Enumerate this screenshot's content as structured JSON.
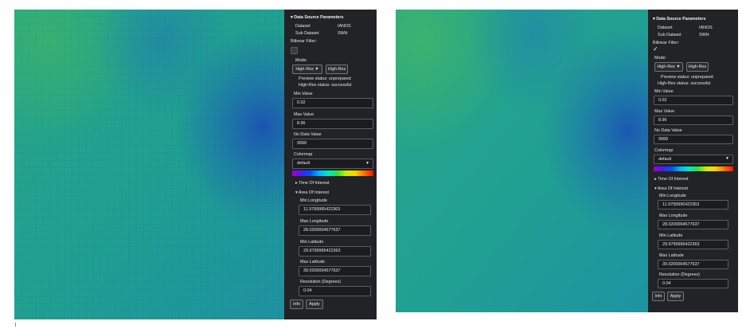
{
  "screens": [
    {
      "id": "left",
      "panel": {
        "section_title": "▾ Data Source Parameters",
        "dataset_label": "Dataset",
        "dataset_value": "IANOS",
        "subdataset_label": "Sub Dataset",
        "subdataset_value": "SWH",
        "bilinear_label": "Bilinear Filter:",
        "bilinear_checked": false,
        "mode_label": "Mode:",
        "mode_selected": "High-Res ▼",
        "mode_button": "High-Res",
        "preview_status": "Preview status: unprepared",
        "highres_status": "High-Res status: successful",
        "min_value_label": "Min Value",
        "min_value": "0.02",
        "max_value_label": "Max Value",
        "max_value": "8.96",
        "no_data_label": "No Data Value",
        "no_data_value": "9999",
        "colormap_label": "Colormap",
        "colormap_value": "default",
        "time_interest": "▸ Time Of Interest",
        "area_interest": "▾ Area Of Interest",
        "min_lon_label": "Min Longitude",
        "min_lon": "11.9799995422363",
        "max_lon_label": "Max Longitude",
        "max_lon": "28.0200004577637",
        "min_lat_label": "Min Latitude",
        "min_lat": "29.9799995422363",
        "max_lat_label": "Max Latitude",
        "max_lat": "39.0200004577637",
        "resolution_label": "Resolution (Degrees)",
        "resolution_value": "0.04",
        "info_button": "Info",
        "apply_button": "Apply"
      }
    },
    {
      "id": "right",
      "panel": {
        "section_title": "▾ Data Source Parameters",
        "dataset_label": "Dataset",
        "dataset_value": "IANOS",
        "subdataset_label": "Sub Dataset",
        "subdataset_value": "SWH",
        "bilinear_label": "Bilinear Filter:",
        "bilinear_checked": true,
        "check_glyph": "✓",
        "mode_label": "Mode:",
        "mode_selected": "High-Res ▼",
        "mode_button": "High-Res",
        "preview_status": "Preview status: unprepared",
        "highres_status": "High-Res status: successful",
        "min_value_label": "Min Value",
        "min_value": "0.02",
        "max_value_label": "Max Value",
        "max_value": "8.96",
        "no_data_label": "No Data Value",
        "no_data_value": "9999",
        "colormap_label": "Colormap",
        "colormap_value": "default",
        "time_interest": "▸ Time Of Interest",
        "area_interest": "▾ Area Of Interest",
        "min_lon_label": "Min Longitude",
        "min_lon": "11.9799995422363",
        "max_lon_label": "Max Longitude",
        "max_lon": "28.0200004577637",
        "min_lat_label": "Min Latitude",
        "min_lat": "29.9799995422363",
        "max_lat_label": "Max Latitude",
        "max_lat": "39.0200004577637",
        "resolution_label": "Resolution (Degrees)",
        "resolution_value": "0.04",
        "info_button": "Info",
        "apply_button": "Apply"
      }
    }
  ],
  "colors": {
    "panel_bg": "#222326",
    "map_teal": "#1fa38e",
    "map_blue": "#1a55b0",
    "map_green": "#2fb07a"
  }
}
